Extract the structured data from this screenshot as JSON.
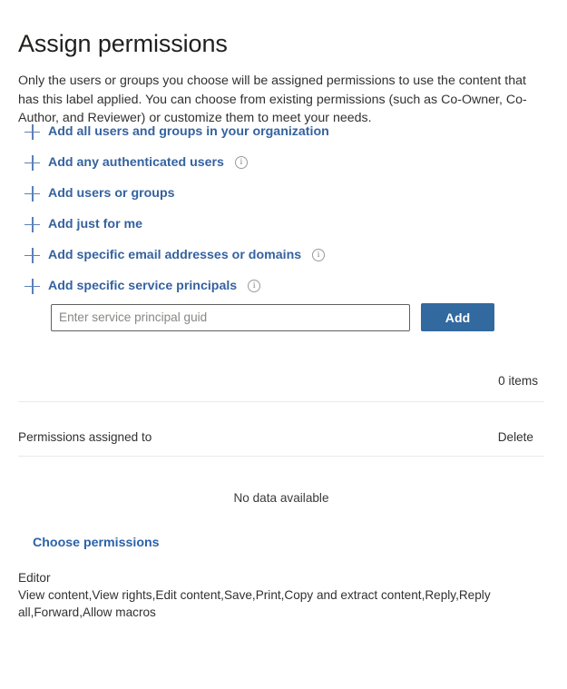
{
  "page": {
    "title": "Assign permissions",
    "description": "Only the users or groups you choose will be assigned permissions to use the content that has this label applied. You can choose from existing permissions (such as Co-Owner, Co-Author, and Reviewer) or customize them to meet your needs."
  },
  "add_options": [
    {
      "label": "Add all users and groups in your organization",
      "icon": "plus-icon",
      "has_info": false
    },
    {
      "label": "Add any authenticated users",
      "icon": "plus-icon",
      "has_info": true
    },
    {
      "label": "Add users or groups",
      "icon": "plus-icon",
      "has_info": false
    },
    {
      "label": "Add just for me",
      "icon": "plus-icon",
      "has_info": false
    },
    {
      "label": "Add specific email addresses or domains",
      "icon": "plus-icon",
      "has_info": true
    },
    {
      "label": "Add specific service principals",
      "icon": "plus-icon",
      "has_info": true
    }
  ],
  "service_principal_form": {
    "input_value": "",
    "input_placeholder": "Enter service principal guid",
    "add_label": "Add"
  },
  "table": {
    "items_count": "0 items",
    "columns": {
      "assigned_to": "Permissions assigned to",
      "delete": "Delete"
    },
    "empty_message": "No data available",
    "rows": []
  },
  "permissions": {
    "choose_link": "Choose permissions",
    "selected_name": "Editor",
    "selected_rights": "View content,View rights,Edit content,Save,Print,Copy and extract content,Reply,Reply all,Forward,Allow macros"
  },
  "colors": {
    "link_blue": "#35629f",
    "button_blue": "#32699f",
    "plus_blue": "#5b80b8",
    "text": "#323130",
    "divider": "#ebe9e7"
  }
}
